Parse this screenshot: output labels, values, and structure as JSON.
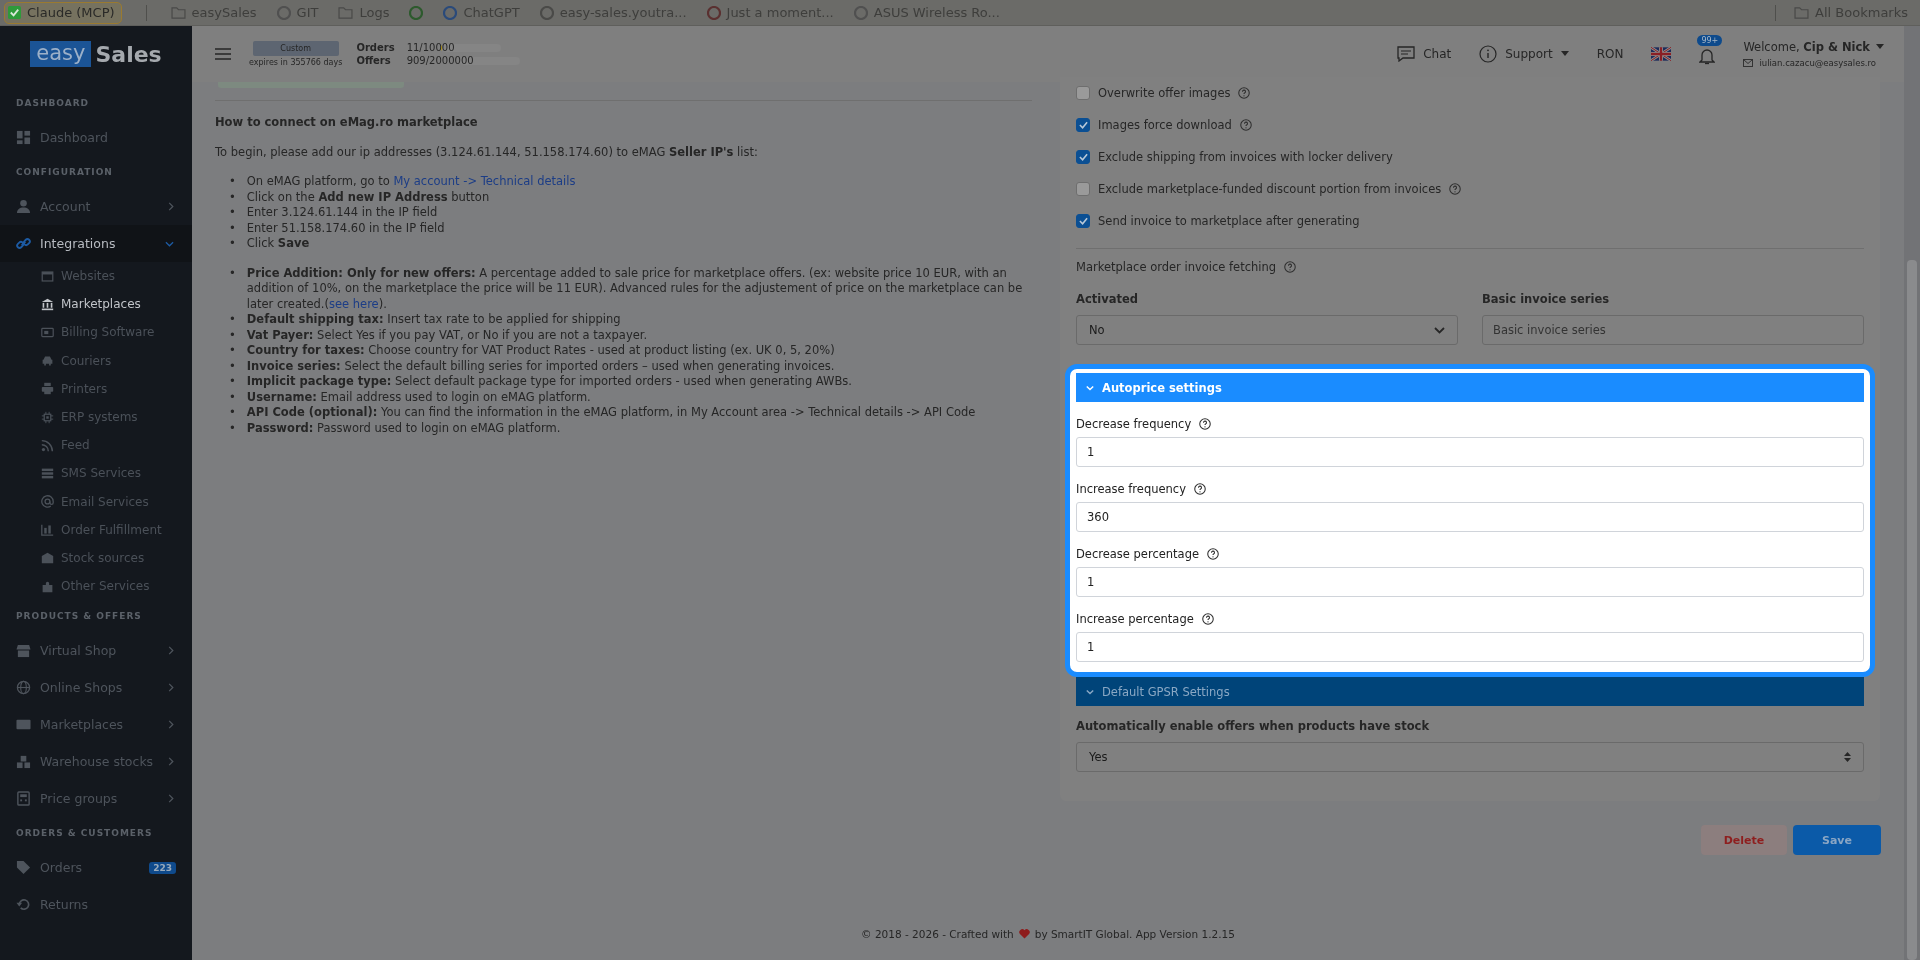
{
  "bookmarks_bar": {
    "items": [
      {
        "kind": "chip",
        "label": "Claude (MCP)"
      },
      {
        "kind": "folder",
        "label": "easySales"
      },
      {
        "kind": "site",
        "label": "GIT"
      },
      {
        "kind": "folder",
        "label": "Logs"
      },
      {
        "kind": "site"
      },
      {
        "kind": "site",
        "label": "ChatGPT"
      },
      {
        "kind": "site",
        "label": "easy-sales.youtra..."
      },
      {
        "kind": "site",
        "label": "Just a moment..."
      },
      {
        "kind": "site",
        "label": "ASUS Wireless Ro..."
      }
    ],
    "all_bookmarks": "All Bookmarks"
  },
  "sidebar": {
    "logo": {
      "left": "easy",
      "right": "Sales"
    },
    "sections": [
      {
        "title": "DASHBOARD",
        "items": [
          {
            "label": "Dashboard"
          }
        ]
      },
      {
        "title": "CONFIGURATION",
        "items": [
          {
            "label": "Account",
            "expanded": false
          },
          {
            "label": "Integrations",
            "expanded": true,
            "children": [
              {
                "label": "Websites",
                "selected": false
              },
              {
                "label": "Marketplaces",
                "selected": true
              },
              {
                "label": "Billing Software",
                "selected": false
              },
              {
                "label": "Couriers",
                "selected": false
              },
              {
                "label": "Printers",
                "selected": false
              },
              {
                "label": "ERP systems",
                "selected": false
              },
              {
                "label": "Feed",
                "selected": false
              },
              {
                "label": "SMS Services",
                "selected": false
              },
              {
                "label": "Email Services",
                "selected": false
              },
              {
                "label": "Order Fulfillment",
                "selected": false
              },
              {
                "label": "Stock sources",
                "selected": false
              },
              {
                "label": "Other Services",
                "selected": false
              }
            ]
          }
        ]
      },
      {
        "title": "PRODUCTS & OFFERS",
        "items": [
          {
            "label": "Virtual Shop",
            "expanded": false
          },
          {
            "label": "Online Shops",
            "expanded": false
          },
          {
            "label": "Marketplaces",
            "expanded": false
          },
          {
            "label": "Warehouse stocks",
            "expanded": false
          },
          {
            "label": "Price groups",
            "expanded": false
          }
        ]
      },
      {
        "title": "ORDERS & CUSTOMERS",
        "items": [
          {
            "label": "Orders",
            "badge": "223"
          },
          {
            "label": "Returns"
          }
        ]
      }
    ]
  },
  "header": {
    "plan": {
      "name": "Custom",
      "expiry": "expires in 355766 days"
    },
    "usage": [
      {
        "label": "Orders",
        "reading": "11/10000",
        "level": 0.02
      },
      {
        "label": "Offers",
        "reading": "909/2000000",
        "level": 0
      }
    ],
    "chat": "Chat",
    "support": "Support",
    "currency": "RON",
    "notifications_badge": "99+",
    "user": {
      "greeting": "Welcome, **Cip & Nick**",
      "email": "iulian.cazacu@easysales.ro"
    }
  },
  "help_text": {
    "title": "How to connect on eMag.ro marketplace",
    "intro": "To begin, please add our ip addresses (3.124.61.144, 51.158.174.60) to eMAG **Seller IP's** list:",
    "bullet": "•",
    "steps": [
      {
        "text": "On eMAG platform, go to ",
        "link": "My account -> Technical details"
      },
      {
        "text": "Click on the **Add new IP Address** button"
      },
      {
        "text": "Enter 3.124.61.144 in the IP field"
      },
      {
        "text": "Enter 51.158.174.60 in the IP field"
      },
      {
        "text": "Click **Save**"
      }
    ],
    "fields": [
      {
        "text": "**Price Addition: Only for new offers:** A percentage added to sale price for marketplace offers. (ex: website price 10 EUR, with an addition of 10%, on the marketplace the price will be 11 EUR). Advanced rules for the adjustement of price on the marketplace can be later created.(",
        "link": "see here",
        "after": ")."
      },
      {
        "text": "**Default shipping tax:** Insert tax rate to be applied for shipping"
      },
      {
        "text": "**Vat Payer:** Select Yes if you pay VAT, or No if you are not a taxpayer."
      },
      {
        "text": "**Country for taxes:** Choose country for VAT Product Rates - used at product listing (ex. UK 0, 5, 20%)"
      },
      {
        "text": "**Invoice series:** Select the default billing series for imported orders – used when generating invoices."
      },
      {
        "text": "**Implicit package type:** Select default package type for imported orders - used when generating AWBs."
      },
      {
        "text": "**Username:** Email address used to login on eMAG platform."
      },
      {
        "text": "**API Code (optional):** You can find the information in the eMAG platform, in My Account area -> Technical details -> API Code"
      },
      {
        "text": "**Password:** Password used to login on eMAG platform."
      }
    ]
  },
  "settings": {
    "checkboxes": [
      {
        "label": "Overwrite offer images",
        "checked": false,
        "help": true
      },
      {
        "label": "Images force download",
        "checked": true,
        "help": true
      },
      {
        "label": "Exclude shipping from invoices with locker delivery",
        "checked": true,
        "help": false
      },
      {
        "label": "Exclude marketplace-funded discount portion from invoices",
        "checked": false,
        "help": true
      },
      {
        "label": "Send invoice to marketplace after generating",
        "checked": true,
        "help": false
      }
    ],
    "invoice_fetching": {
      "title": "Marketplace order invoice fetching",
      "help": true,
      "activated": {
        "label": "Activated",
        "value": "No"
      },
      "series": {
        "label": "Basic invoice series",
        "placeholder": "Basic invoice series"
      }
    },
    "autoprice": {
      "title": "Autoprice settings",
      "expanded": true,
      "highlighted": true,
      "fields": [
        {
          "label": "Decrease frequency",
          "value": "1"
        },
        {
          "label": "Increase frequency",
          "value": "360"
        },
        {
          "label": "Decrease percentage",
          "value": "1"
        },
        {
          "label": "Increase percentage",
          "value": "1"
        }
      ]
    },
    "gpsr": {
      "title": "Default GPSR Settings",
      "highlighted": false
    },
    "auto_enable": {
      "label": "Automatically enable offers when products have stock",
      "value": "Yes"
    }
  },
  "buttons": [
    {
      "kind": "danger",
      "label": "Delete"
    },
    {
      "kind": "primary",
      "label": "Save"
    }
  ],
  "footer": {
    "before": "© 2018 - 2026 - Crafted with",
    "after": "by SmartIT Global. App Version 1.2.15"
  }
}
